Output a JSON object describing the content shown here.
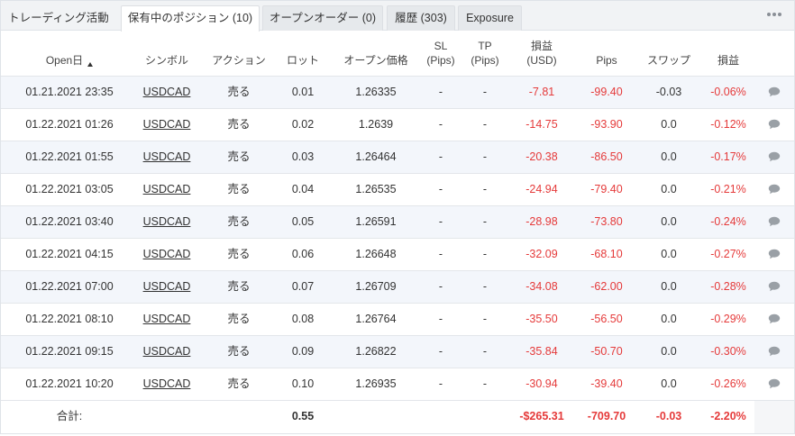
{
  "tabs": [
    {
      "label": "トレーディング活動",
      "active": false
    },
    {
      "label": "保有中のポジション (10)",
      "active": true
    },
    {
      "label": "オープンオーダー (0)",
      "active": false
    },
    {
      "label": "履歴 (303)",
      "active": false
    },
    {
      "label": "Exposure",
      "active": false
    }
  ],
  "headers": {
    "open": "Open日",
    "symbol": "シンボル",
    "action": "アクション",
    "lot": "ロット",
    "open_price": "オープン価格",
    "sl_line1": "SL",
    "sl_line2": "(Pips)",
    "tp_line1": "TP",
    "tp_line2": "(Pips)",
    "profit_usd_line1": "損益",
    "profit_usd_line2": "(USD)",
    "pips": "Pips",
    "swap": "スワップ",
    "profit_pct": "損益"
  },
  "rows": [
    {
      "open": "01.21.2021 23:35",
      "symbol": "USDCAD",
      "action": "売る",
      "lot": "0.01",
      "price": "1.26335",
      "sl": "-",
      "tp": "-",
      "usd": "-7.81",
      "pips": "-99.40",
      "swap": "-0.03",
      "pct": "-0.06%"
    },
    {
      "open": "01.22.2021 01:26",
      "symbol": "USDCAD",
      "action": "売る",
      "lot": "0.02",
      "price": "1.2639",
      "sl": "-",
      "tp": "-",
      "usd": "-14.75",
      "pips": "-93.90",
      "swap": "0.0",
      "pct": "-0.12%"
    },
    {
      "open": "01.22.2021 01:55",
      "symbol": "USDCAD",
      "action": "売る",
      "lot": "0.03",
      "price": "1.26464",
      "sl": "-",
      "tp": "-",
      "usd": "-20.38",
      "pips": "-86.50",
      "swap": "0.0",
      "pct": "-0.17%"
    },
    {
      "open": "01.22.2021 03:05",
      "symbol": "USDCAD",
      "action": "売る",
      "lot": "0.04",
      "price": "1.26535",
      "sl": "-",
      "tp": "-",
      "usd": "-24.94",
      "pips": "-79.40",
      "swap": "0.0",
      "pct": "-0.21%"
    },
    {
      "open": "01.22.2021 03:40",
      "symbol": "USDCAD",
      "action": "売る",
      "lot": "0.05",
      "price": "1.26591",
      "sl": "-",
      "tp": "-",
      "usd": "-28.98",
      "pips": "-73.80",
      "swap": "0.0",
      "pct": "-0.24%"
    },
    {
      "open": "01.22.2021 04:15",
      "symbol": "USDCAD",
      "action": "売る",
      "lot": "0.06",
      "price": "1.26648",
      "sl": "-",
      "tp": "-",
      "usd": "-32.09",
      "pips": "-68.10",
      "swap": "0.0",
      "pct": "-0.27%"
    },
    {
      "open": "01.22.2021 07:00",
      "symbol": "USDCAD",
      "action": "売る",
      "lot": "0.07",
      "price": "1.26709",
      "sl": "-",
      "tp": "-",
      "usd": "-34.08",
      "pips": "-62.00",
      "swap": "0.0",
      "pct": "-0.28%"
    },
    {
      "open": "01.22.2021 08:10",
      "symbol": "USDCAD",
      "action": "売る",
      "lot": "0.08",
      "price": "1.26764",
      "sl": "-",
      "tp": "-",
      "usd": "-35.50",
      "pips": "-56.50",
      "swap": "0.0",
      "pct": "-0.29%"
    },
    {
      "open": "01.22.2021 09:15",
      "symbol": "USDCAD",
      "action": "売る",
      "lot": "0.09",
      "price": "1.26822",
      "sl": "-",
      "tp": "-",
      "usd": "-35.84",
      "pips": "-50.70",
      "swap": "0.0",
      "pct": "-0.30%"
    },
    {
      "open": "01.22.2021 10:20",
      "symbol": "USDCAD",
      "action": "売る",
      "lot": "0.10",
      "price": "1.26935",
      "sl": "-",
      "tp": "-",
      "usd": "-30.94",
      "pips": "-39.40",
      "swap": "0.0",
      "pct": "-0.26%"
    }
  ],
  "totals": {
    "label": "合計:",
    "lot": "0.55",
    "usd": "-$265.31",
    "pips": "-709.70",
    "swap": "-0.03",
    "pct": "-2.20%"
  },
  "icons": {
    "more": "more-horizontal-icon",
    "comment": "comment-bubble-icon",
    "sort": "sort-ascending-icon"
  },
  "colors": {
    "negative": "#e53a3a",
    "row_alt": "#f3f6fb",
    "tab_bg": "#f1f3f5"
  }
}
